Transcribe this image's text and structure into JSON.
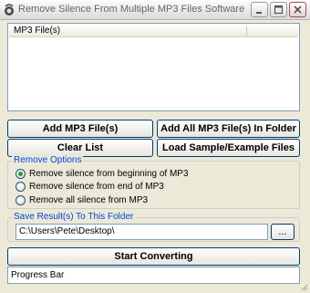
{
  "window": {
    "title": "Remove Silence From Multiple MP3 Files Software"
  },
  "file_list": {
    "column_header": "MP3 File(s)",
    "items": []
  },
  "buttons": {
    "add_files": "Add MP3 File(s)",
    "add_folder": "Add All MP3 File(s) In Folder",
    "clear_list": "Clear List",
    "load_sample": "Load Sample/Example Files",
    "browse": "...",
    "start": "Start Converting"
  },
  "remove_options": {
    "legend": "Remove Options",
    "options": [
      {
        "label": "Remove silence from beginning of MP3",
        "selected": true
      },
      {
        "label": "Remove silence from end of MP3",
        "selected": false
      },
      {
        "label": "Remove all silence from MP3",
        "selected": false
      }
    ]
  },
  "save_folder": {
    "legend": "Save Result(s) To This Folder",
    "path": "C:\\Users\\Pete\\Desktop\\"
  },
  "progress": {
    "text": "Progress Bar"
  }
}
